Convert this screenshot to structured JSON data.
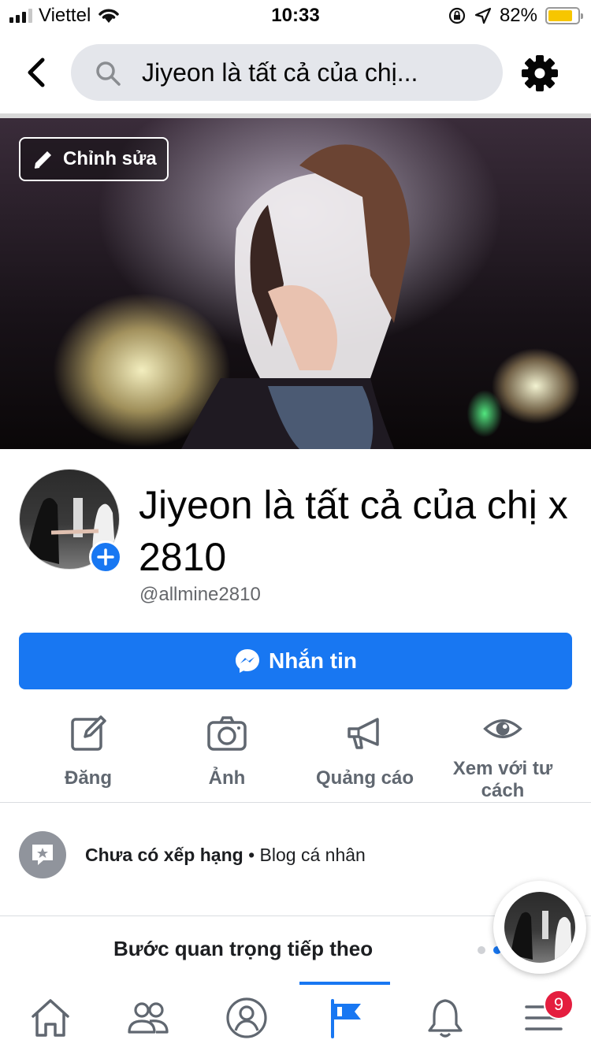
{
  "status_bar": {
    "carrier": "Viettel",
    "time": "10:33",
    "battery_percent": "82%",
    "battery_level": 0.82,
    "signal_bars_active": 3,
    "signal_bars_total": 4
  },
  "header": {
    "search_text": "Jiyeon là tất cả của chị...",
    "icons": [
      "back-arrow-icon",
      "search-icon",
      "gear-icon"
    ]
  },
  "cover": {
    "edit_label": "Chỉnh sửa"
  },
  "profile": {
    "name": "Jiyeon là tất cả của chị x 2810",
    "username": "@allmine2810"
  },
  "message_button": {
    "label": "Nhắn tin"
  },
  "actions": [
    {
      "label": "Đăng",
      "icon": "edit-icon"
    },
    {
      "label": "Ảnh",
      "icon": "camera-icon"
    },
    {
      "label": "Quảng cáo",
      "icon": "megaphone-icon"
    },
    {
      "label": "Xem với tư cách",
      "icon": "eye-icon"
    }
  ],
  "info": {
    "rating": "Chưa có xếp hạng",
    "separator": "•",
    "category": "Blog cá nhân"
  },
  "next_step": {
    "title": "Bước quan trọng tiếp theo",
    "dots_total": 2,
    "dots_active_index": 1
  },
  "tabbar": {
    "tabs": [
      "home-icon",
      "groups-icon",
      "profile-icon",
      "pages-flag-icon",
      "notifications-bell-icon",
      "menu-icon"
    ],
    "active_index": 3,
    "menu_badge": "9"
  },
  "colors": {
    "accent": "#1877f2",
    "badge": "#e41e3f",
    "battery": "#f7c600"
  }
}
